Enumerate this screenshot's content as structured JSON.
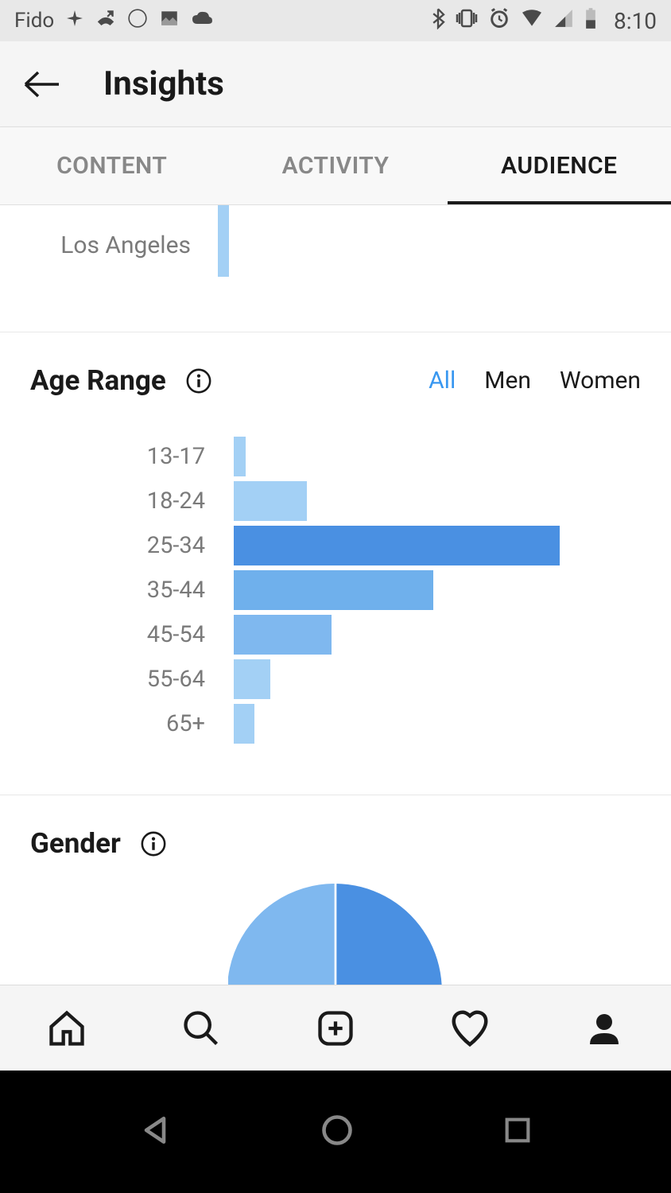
{
  "status_bar": {
    "carrier": "Fido",
    "time": "8:10"
  },
  "header": {
    "title": "Insights"
  },
  "tabs": [
    {
      "label": "CONTENT",
      "active": false
    },
    {
      "label": "ACTIVITY",
      "active": false
    },
    {
      "label": "AUDIENCE",
      "active": true
    }
  ],
  "location": {
    "label": "Los Angeles",
    "value": 5
  },
  "age_range": {
    "title": "Age Range",
    "filters": [
      {
        "label": "All",
        "active": true
      },
      {
        "label": "Men",
        "active": false
      },
      {
        "label": "Women",
        "active": false
      }
    ]
  },
  "gender": {
    "title": "Gender"
  },
  "chart_data": [
    {
      "type": "bar",
      "title": "Age Range",
      "orientation": "horizontal",
      "categories": [
        "13-17",
        "18-24",
        "25-34",
        "35-44",
        "45-54",
        "55-64",
        "65+"
      ],
      "values": [
        3,
        18,
        80,
        49,
        24,
        9,
        5
      ],
      "colors": [
        "#a3d0f5",
        "#a3d0f5",
        "#4a90e2",
        "#6fb0ec",
        "#7fb8ef",
        "#a3d0f5",
        "#a3d0f5"
      ],
      "xlim": [
        0,
        100
      ]
    },
    {
      "type": "pie",
      "title": "Gender",
      "series": [
        {
          "name": "segment1",
          "value": 55,
          "color": "#4a90e2"
        },
        {
          "name": "segment2",
          "value": 45,
          "color": "#7fb8ef"
        }
      ]
    }
  ]
}
